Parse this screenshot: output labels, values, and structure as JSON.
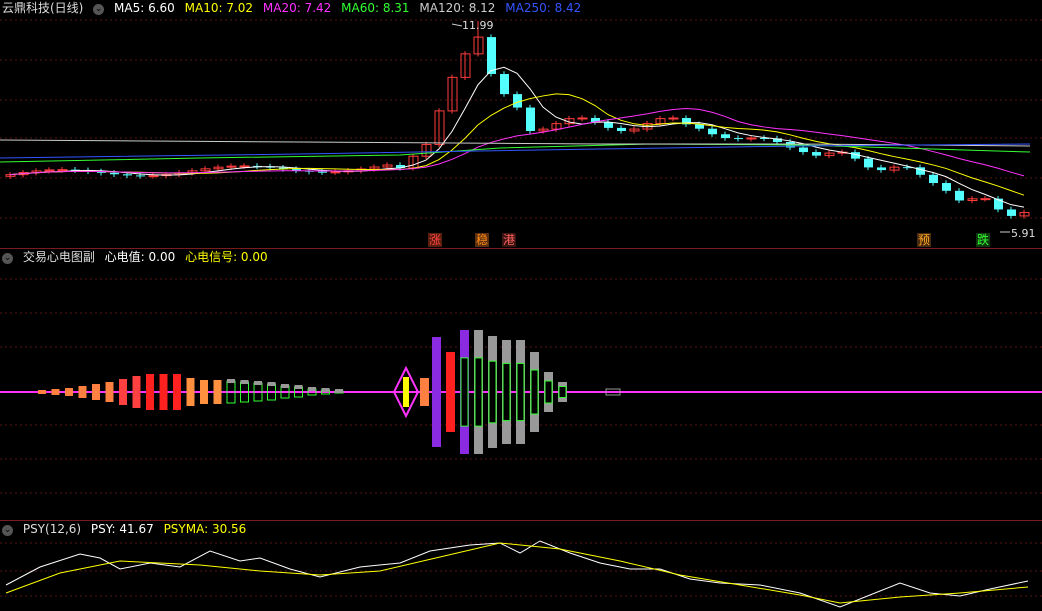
{
  "main": {
    "title": "云鼎科技(日线)",
    "ma": [
      {
        "label": "MA5: 6.60",
        "color": "#ffffff"
      },
      {
        "label": "MA10: 7.02",
        "color": "#ffff00"
      },
      {
        "label": "MA20: 7.42",
        "color": "#ff33ff"
      },
      {
        "label": "MA60: 8.31",
        "color": "#33ff33"
      },
      {
        "label": "MA120: 8.12",
        "color": "#cccccc"
      },
      {
        "label": "MA250: 8.42",
        "color": "#3333ff"
      }
    ],
    "high_label": "11.99",
    "low_label": "5.91",
    "signals": [
      {
        "text": "涨",
        "color": "#ff4040",
        "bg": "#5a1e0e"
      },
      {
        "text": "稳",
        "color": "#ff8c1a",
        "bg": "#5a2e0e"
      },
      {
        "text": "港",
        "color": "#ff6060",
        "bg": "#3a1410"
      },
      {
        "text": "预",
        "color": "#ffaa22",
        "bg": "#4a2a0e"
      },
      {
        "text": "跌",
        "color": "#33ff33",
        "bg": "#0e3a0e"
      }
    ]
  },
  "ecg": {
    "title": "交易心电图副",
    "value_label": "心电值: 0.00",
    "signal_label": "心电信号: 0.00"
  },
  "psy": {
    "title": "PSY(12,6)",
    "psy_label": "PSY: 41.67",
    "psyma_label": "PSYMA: 30.56"
  }
}
